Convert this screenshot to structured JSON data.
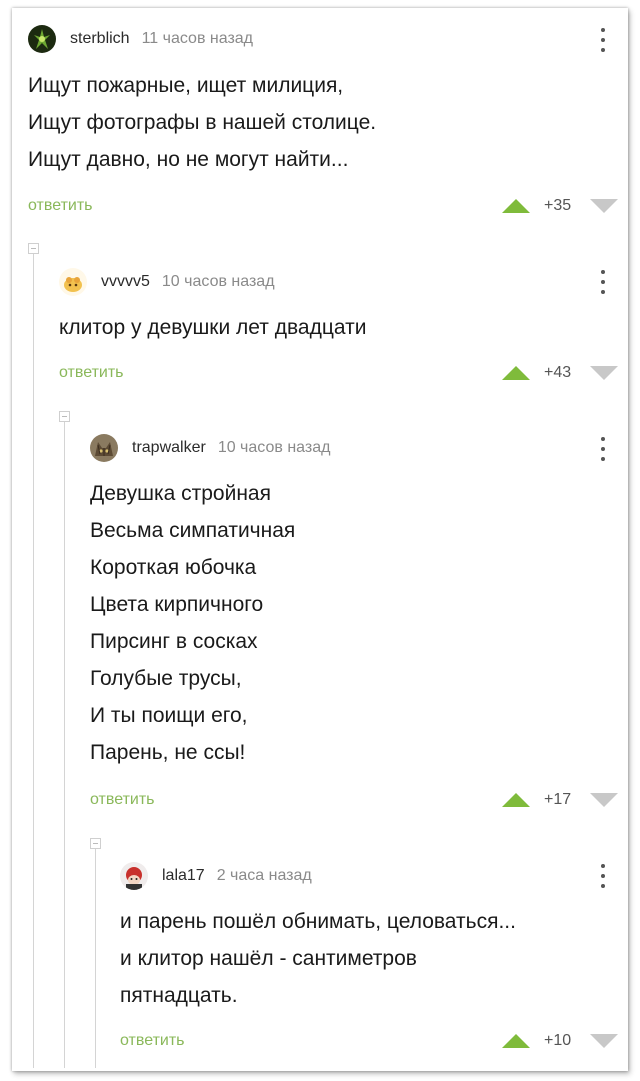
{
  "comments": [
    {
      "username": "sterblich",
      "time": "11 часов назад",
      "lines": [
        "Ищут пожарные, ищет милиция,",
        "Ищут фотографы в нашей столице.",
        "Ищут давно, но не могут найти..."
      ],
      "reply": "ответить",
      "score": "+35"
    },
    {
      "username": "vvvvv5",
      "time": "10 часов назад",
      "lines": [
        "клитор у девушки лет двадцати"
      ],
      "reply": "ответить",
      "score": "+43"
    },
    {
      "username": "trapwalker",
      "time": "10 часов назад",
      "lines": [
        "Девушка стройная",
        "Весьма симпатичная",
        "Короткая юбочка",
        "Цвета кирпичного",
        "Пирсинг в сосках",
        "Голубые трусы,",
        "И ты поищи его,",
        "Парень, не ссы!"
      ],
      "reply": "ответить",
      "score": "+17"
    },
    {
      "username": "lala17",
      "time": "2 часа назад",
      "lines": [
        "и парень пошёл обнимать, целоваться...",
        "и клитор нашёл - сантиметров",
        "пятнадцать."
      ],
      "reply": "ответить",
      "score": "+10"
    }
  ],
  "icons": {
    "menu": "more-vertical-icon",
    "upvote": "arrow-up-icon",
    "downvote": "arrow-down-icon",
    "collapse": "collapse-icon"
  },
  "colors": {
    "reply_link": "#8ab85a",
    "upvote": "#7fbb3b",
    "downvote": "#c8c8c8",
    "thread_line": "#d4d4d4"
  }
}
